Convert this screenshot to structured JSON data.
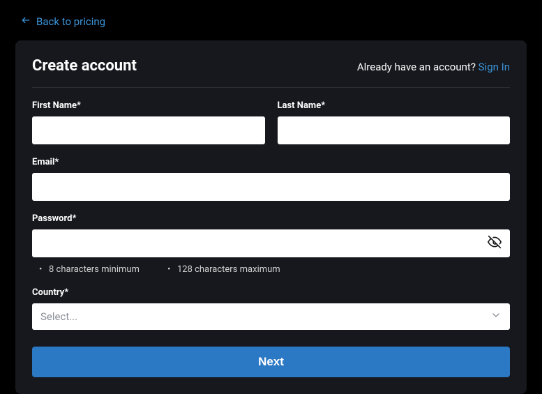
{
  "nav": {
    "back_label": "Back to pricing"
  },
  "header": {
    "title": "Create account",
    "signin_prompt": "Already have an account? ",
    "signin_link": "Sign In"
  },
  "form": {
    "first_name": {
      "label": "First Name*",
      "value": ""
    },
    "last_name": {
      "label": "Last Name*",
      "value": ""
    },
    "email": {
      "label": "Email*",
      "value": ""
    },
    "password": {
      "label": "Password*",
      "value": "",
      "hint_min": "8 characters minimum",
      "hint_max": "128 characters maximum"
    },
    "country": {
      "label": "Country*",
      "placeholder": "Select..."
    },
    "submit_label": "Next"
  },
  "colors": {
    "link": "#3b94d9",
    "card_bg": "#16181d",
    "button_bg": "#2b78c5"
  }
}
